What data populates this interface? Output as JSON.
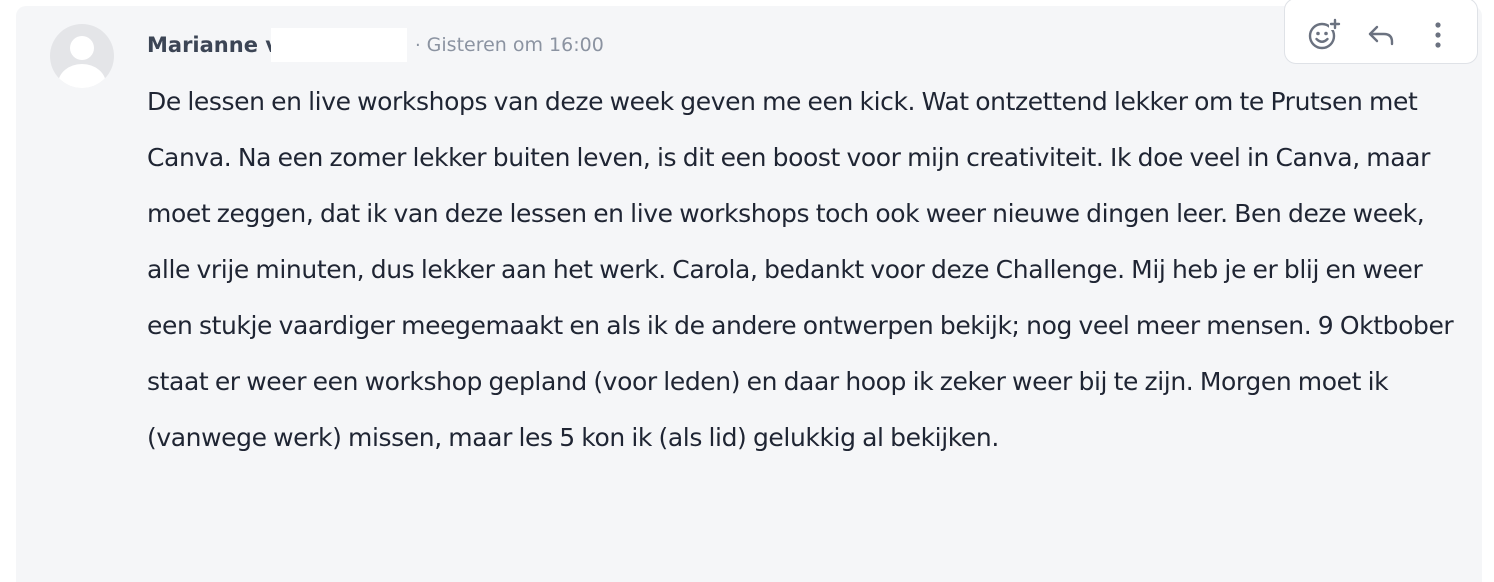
{
  "comment": {
    "author_name": "Marianne v",
    "separator": "·",
    "timestamp": "Gisteren om 16:00",
    "paragraphs": [
      "De lessen en live workshops van deze week geven me een kick. Wat ontzettend lekker om te Prutsen met Canva. Na een zomer lekker buiten leven, is dit een boost voor mijn creativiteit. Ik doe veel in Canva, maar moet zeggen, dat ik van deze lessen en live workshops toch ook weer nieuwe dingen leer. Ben deze week, alle vrije minuten, dus lekker aan het werk. Carola, bedankt voor deze Challenge. Mij heb je er blij en weer een stukje vaardiger meegemaakt en als ik de andere ontwerpen bekijk; nog veel meer mensen. 9 Oktbober staat er weer een workshop gepland (voor leden) en daar hoop ik zeker weer bij te zijn. Morgen moet ik (vanwege werk) missen, maar les 5 kon ik (als lid) gelukkig al bekijken."
    ]
  },
  "toolbar": {
    "icons": [
      "add-reaction-icon",
      "reply-icon",
      "more-options-icon"
    ]
  },
  "colors": {
    "card_background": "#f5f6f8",
    "author": "#3c4555",
    "meta": "#8b93a1",
    "body_text": "#1f2533",
    "icon": "#6b7280"
  }
}
